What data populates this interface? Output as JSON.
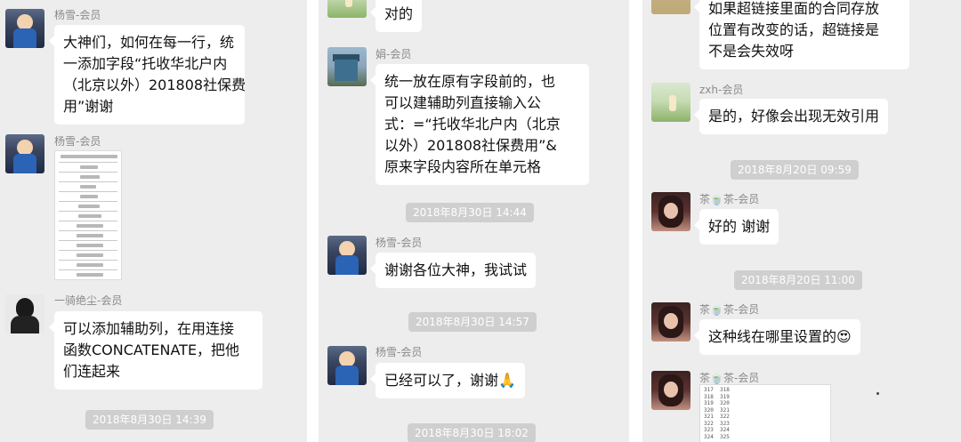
{
  "panel1": {
    "msg1": {
      "name": "杨雪-会员",
      "lines": [
        "大神们，如何在每一行，统",
        "一添加字段“托收华北户内",
        "（北京以外）201808社保费",
        "用”谢谢"
      ]
    },
    "msg2": {
      "name": "杨雪-会员"
    },
    "msg3": {
      "name": "一骑绝尘-会员",
      "lines": [
        "可以添加辅助列，在用连接",
        "函数CONCATENATE，把他",
        "们连起来"
      ]
    },
    "timestamp1": "2018年8月30日 14:39"
  },
  "panel2": {
    "msg0": {
      "lines": [
        "对的"
      ]
    },
    "msg1": {
      "name": "娟-会员",
      "lines": [
        "统一放在原有字段前的，也",
        "可以建辅助列直接输入公",
        "式：=“托收华北户内（北京",
        "以外）201808社保费用”&",
        "原来字段内容所在单元格"
      ]
    },
    "timestamp1": "2018年8月30日 14:44",
    "msg2": {
      "name": "杨雪-会员",
      "lines": [
        "谢谢各位大神，我试试"
      ]
    },
    "timestamp2": "2018年8月30日 14:57",
    "msg3": {
      "name": "杨雪-会员",
      "lines": [
        "已经可以了，谢谢🙏"
      ]
    },
    "timestamp3": "2018年8月30日 18:02"
  },
  "panel3": {
    "msg0": {
      "lines": [
        "如果超链接里面的合同存放",
        "位置有改变的话，超链接是",
        "不是会失效呀"
      ]
    },
    "msg1": {
      "name": "zxh-会员",
      "lines": [
        "是的，好像会出现无效引用"
      ]
    },
    "timestamp1": "2018年8月20日 09:59",
    "msg2": {
      "name": "茶🍵茶-会员",
      "lines": [
        "好的 谢谢"
      ]
    },
    "timestamp2": "2018年8月20日 11:00",
    "msg3": {
      "name": "茶🍵茶-会员",
      "lines": [
        "这种线在哪里设置的😍"
      ]
    },
    "msg4": {
      "name": "茶🍵茶-会员",
      "grid_rows": [
        "317  318",
        "318  319",
        "319  320",
        "320  321",
        "321  322",
        "322  323",
        "323  324",
        "324  325"
      ]
    }
  }
}
